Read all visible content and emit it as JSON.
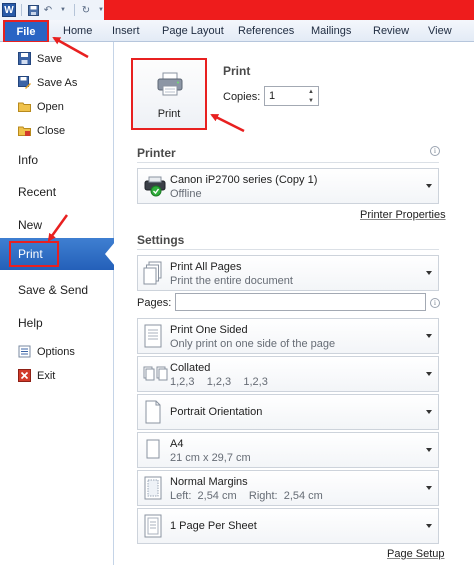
{
  "quick_access": {
    "app_icon_letter": "W"
  },
  "ribbon": {
    "file": "File",
    "tabs": [
      "Home",
      "Insert",
      "Page Layout",
      "References",
      "Mailings",
      "Review",
      "View"
    ]
  },
  "backstage_nav": {
    "commands_top": [
      {
        "label": "Save",
        "icon": "save-icon"
      },
      {
        "label": "Save As",
        "icon": "save-as-icon"
      },
      {
        "label": "Open",
        "icon": "open-folder-icon"
      },
      {
        "label": "Close",
        "icon": "close-folder-icon"
      }
    ],
    "pages": [
      "Info",
      "Recent",
      "New",
      "Print",
      "Save & Send",
      "Help"
    ],
    "selected": "Print",
    "commands_bottom": [
      {
        "label": "Options",
        "icon": "options-icon"
      },
      {
        "label": "Exit",
        "icon": "exit-icon"
      }
    ]
  },
  "print_panel": {
    "heading": "Print",
    "print_button": "Print",
    "copies_label": "Copies:",
    "copies_value": "1",
    "printer_section": "Printer",
    "printer_name": "Canon iP2700 series (Copy 1)",
    "printer_status": "Offline",
    "printer_properties": "Printer Properties",
    "settings_section": "Settings",
    "pages_label": "Pages:",
    "page_setup": "Page Setup",
    "settings": [
      {
        "title": "Print All Pages",
        "subtitle": "Print the entire document",
        "icon": "all-pages-icon"
      },
      {
        "title": "Print One Sided",
        "subtitle": "Only print on one side of the page",
        "icon": "one-sided-icon"
      },
      {
        "title": "Collated",
        "subtitle": "1,2,3    1,2,3    1,2,3",
        "icon": "collated-icon"
      },
      {
        "title": "Portrait Orientation",
        "subtitle": "",
        "icon": "portrait-icon"
      },
      {
        "title": "A4",
        "subtitle": "21 cm x 29,7 cm",
        "icon": "paper-size-icon"
      },
      {
        "title": "Normal Margins",
        "subtitle": "Left:  2,54 cm    Right:  2,54 cm",
        "icon": "margins-icon"
      },
      {
        "title": "1 Page Per Sheet",
        "subtitle": "",
        "icon": "pages-per-sheet-icon"
      }
    ]
  },
  "colors": {
    "annotation_red": "#e82020",
    "title_red": "#ee1c1c",
    "file_blue": "#2a64c4",
    "selection_blue": "#2f6fc6"
  }
}
